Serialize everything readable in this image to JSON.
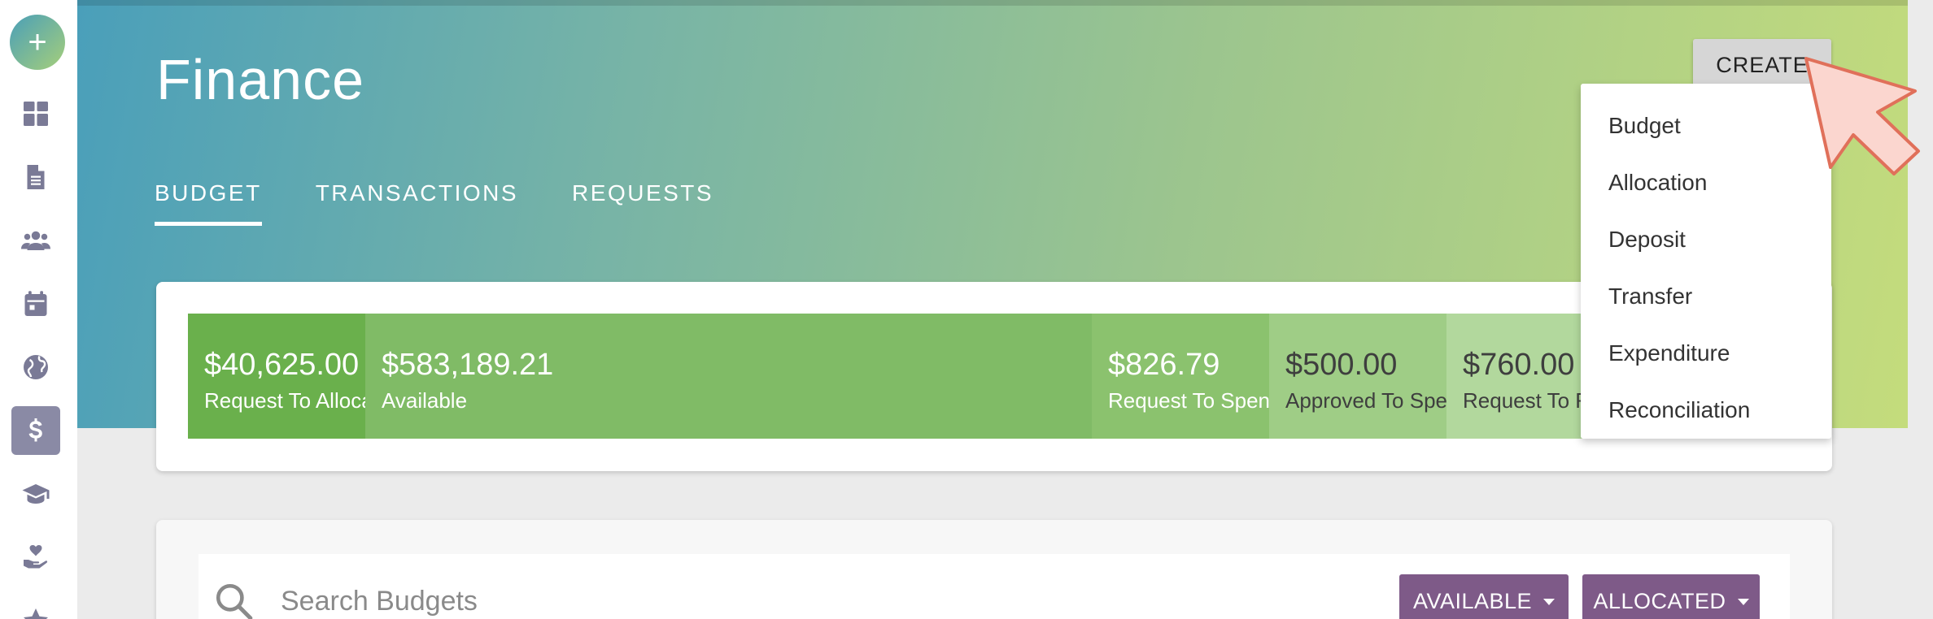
{
  "sidebar": {
    "fab_label": "+",
    "items": [
      {
        "icon": "dashboard-icon"
      },
      {
        "icon": "document-icon"
      },
      {
        "icon": "users-icon"
      },
      {
        "icon": "calendar-icon"
      },
      {
        "icon": "globe-icon"
      },
      {
        "icon": "dollar-icon",
        "active": true
      },
      {
        "icon": "graduation-cap-icon"
      },
      {
        "icon": "hand-heart-icon"
      },
      {
        "icon": "star-icon"
      }
    ]
  },
  "header": {
    "title": "Finance",
    "tabs": [
      {
        "label": "BUDGET",
        "active": true
      },
      {
        "label": "TRANSACTIONS"
      },
      {
        "label": "REQUESTS"
      }
    ],
    "create_label": "CREATE"
  },
  "create_menu": {
    "items": [
      "Budget",
      "Allocation",
      "Deposit",
      "Transfer",
      "Expenditure",
      "Reconciliation"
    ]
  },
  "summary": {
    "segments": [
      {
        "amount": "$40,625.00",
        "label": "Request To Allocate",
        "color": "#6ab04c"
      },
      {
        "amount": "$583,189.21",
        "label": "Available",
        "color": "#80bb66"
      },
      {
        "amount": "$826.79",
        "label": "Request To Spend",
        "color": "#8bc26e"
      },
      {
        "amount": "$500.00",
        "label": "Approved To Spend",
        "color": "#9fcd86"
      },
      {
        "amount": "$760.00",
        "label": "Request To Reconcile",
        "color": "#b2d89d"
      }
    ]
  },
  "search": {
    "placeholder": "Search Budgets",
    "filters": [
      {
        "label": "AVAILABLE"
      },
      {
        "label": "ALLOCATED"
      }
    ]
  },
  "colors": {
    "accent": "#7e5a88",
    "sidebar_icon": "#7a7a96"
  }
}
